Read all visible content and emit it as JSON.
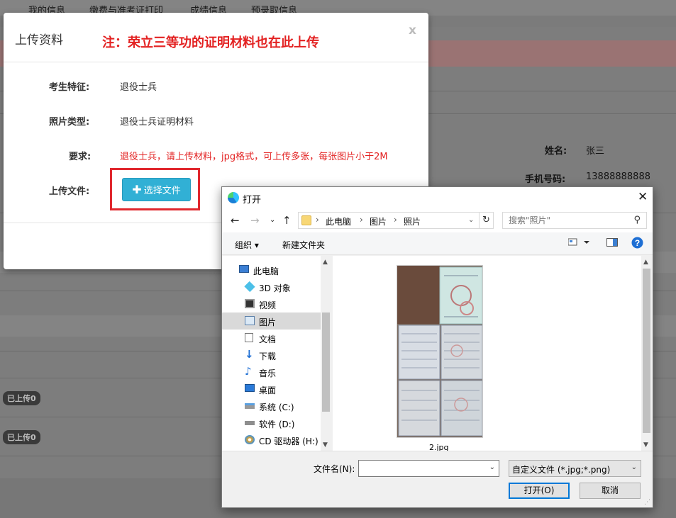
{
  "background": {
    "nav": [
      "我的信息",
      "缴费与准考证打印",
      "成绩信息",
      "预录取信息"
    ],
    "name_label": "姓名:",
    "name_value": "张三",
    "phone_label": "手机号码:",
    "phone_value": "13888888888",
    "badges": [
      "已上传0",
      "已上传0"
    ]
  },
  "modal": {
    "title": "上传资料",
    "note": "注：荣立三等功的证明材料也在此上传",
    "close": "x",
    "fields": [
      {
        "label": "考生特征:",
        "value": "退役士兵"
      },
      {
        "label": "照片类型:",
        "value": "退役士兵证明材料"
      },
      {
        "label": "要求:",
        "value": "退役士兵，请上传材料，jpg格式，可上传多张，每张图片小于2M"
      }
    ],
    "upload_label": "上传文件:",
    "upload_button": "选择文件",
    "accent": "#e32222",
    "button_color": "#31b0d5"
  },
  "dialog": {
    "title": "打开",
    "close": "✕",
    "breadcrumb": [
      "此电脑",
      "图片",
      "照片"
    ],
    "search_placeholder": "搜索\"照片\"",
    "toolbar": {
      "organize": "组织 ▾",
      "new_folder": "新建文件夹"
    },
    "tree": [
      {
        "label": "此电脑",
        "icon": "computer-icon"
      },
      {
        "label": "3D 对象",
        "icon": "cube-icon"
      },
      {
        "label": "视频",
        "icon": "video-icon"
      },
      {
        "label": "图片",
        "icon": "picture-icon",
        "selected": true
      },
      {
        "label": "文档",
        "icon": "document-icon"
      },
      {
        "label": "下载",
        "icon": "download-icon"
      },
      {
        "label": "音乐",
        "icon": "music-icon"
      },
      {
        "label": "桌面",
        "icon": "desktop-icon"
      },
      {
        "label": "系统 (C:)",
        "icon": "drive-icon"
      },
      {
        "label": "软件 (D:)",
        "icon": "drive-icon"
      },
      {
        "label": "CD 驱动器 (H:)",
        "icon": "cd-drive-icon"
      }
    ],
    "file": {
      "name": "2.jpg"
    },
    "filename_label": "文件名(N):",
    "filename_value": "",
    "filetype": "自定义文件 (*.jpg;*.png)",
    "open_button": "打开(O)",
    "cancel_button": "取消"
  }
}
